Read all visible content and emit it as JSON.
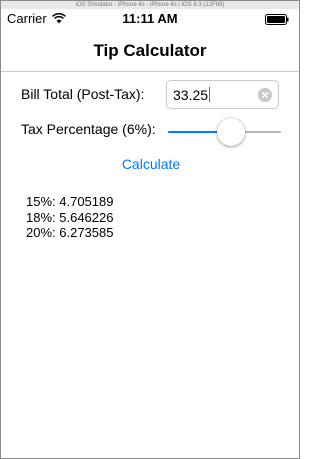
{
  "simulator": {
    "title": "iOS Simulator - iPhone 4s - iPhone 4s / iOS 8.3 (12F69)"
  },
  "status_bar": {
    "carrier": "Carrier",
    "time": "11:11 AM",
    "wifi_icon": "wifi-icon",
    "battery_icon": "battery-icon"
  },
  "nav": {
    "title": "Tip Calculator"
  },
  "bill": {
    "label": "Bill Total (Post-Tax):",
    "value": "33.25",
    "clear_icon": "clear-icon"
  },
  "tax": {
    "label": "Tax Percentage (6%):",
    "slider_fraction": 0.58
  },
  "calculate": {
    "label": "Calculate"
  },
  "results": [
    {
      "text": "15%: 4.705189"
    },
    {
      "text": "18%: 5.646226"
    },
    {
      "text": "20%: 6.273585"
    }
  ],
  "colors": {
    "accent": "#007aff",
    "separator": "#c8c7cc",
    "clear": "#c7c7cc"
  }
}
